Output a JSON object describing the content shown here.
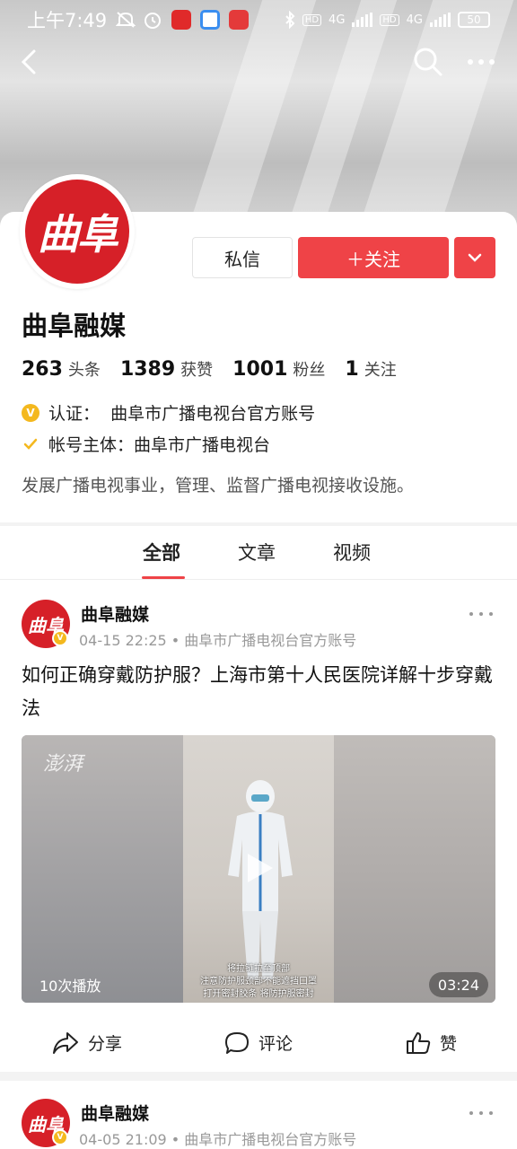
{
  "status": {
    "time": "上午7:49",
    "battery": "50",
    "network_1": "4G",
    "network_2": "4G",
    "hd_1": "HD",
    "hd_2": "HD"
  },
  "colors": {
    "accent": "#ef4347",
    "brand_red": "#d62028",
    "verify_gold": "#f4b81e"
  },
  "profile": {
    "avatar_text": "曲阜",
    "name": "曲阜融媒",
    "message_button": "私信",
    "follow_button": "＋关注",
    "stats": [
      {
        "num": "263",
        "label": "头条"
      },
      {
        "num": "1389",
        "label": "获赞"
      },
      {
        "num": "1001",
        "label": "粉丝"
      },
      {
        "num": "1",
        "label": "关注"
      }
    ],
    "verify_badge": "V",
    "verify_text": "认证：  曲阜市广播电视台官方账号",
    "owner_text": "帐号主体：曲阜市广播电视台",
    "bio": "发展广播电视事业，管理、监督广播电视接收设施。"
  },
  "tabs": [
    {
      "label": "全部",
      "active": true
    },
    {
      "label": "文章",
      "active": false
    },
    {
      "label": "视频",
      "active": false
    }
  ],
  "posts": [
    {
      "author": "曲阜融媒",
      "avatar_text": "曲阜",
      "meta": "04-15 22:25 • 曲阜市广播电视台官方账号",
      "title": "如何正确穿戴防护服？上海市第十人民医院详解十步穿戴法",
      "video": {
        "watermark": "澎湃",
        "subtitle_1": "将拉链拉至顶部",
        "subtitle_2": "注意防护服颈部不能遮挡口罩",
        "subtitle_3": "打开密封胶条 将防护服密封",
        "plays": "10次播放",
        "duration": "03:24"
      },
      "actions": {
        "share": "分享",
        "comment": "评论",
        "like": "赞"
      }
    },
    {
      "author": "曲阜融媒",
      "avatar_text": "曲阜",
      "meta": "04-05 21:09 • 曲阜市广播电视台官方账号"
    }
  ],
  "icons": [
    "back-icon",
    "search-icon",
    "more-icon",
    "chevron-down-icon",
    "share-icon",
    "comment-icon",
    "like-icon",
    "play-icon",
    "verified-icon",
    "check-icon"
  ]
}
